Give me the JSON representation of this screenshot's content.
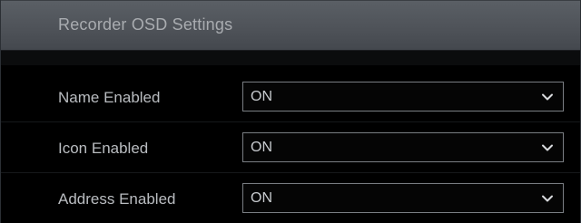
{
  "header": {
    "title": "Recorder OSD Settings"
  },
  "settings": [
    {
      "label": "Name Enabled",
      "value": "ON"
    },
    {
      "label": "Icon Enabled",
      "value": "ON"
    },
    {
      "label": "Address Enabled",
      "value": "ON"
    }
  ],
  "icons": {
    "dropdown": "chevron-down-icon"
  },
  "colors": {
    "header_bg": "#51565c",
    "panel_bg": "#000000",
    "text": "#b9bcc0",
    "field_border": "#7a7e83"
  }
}
